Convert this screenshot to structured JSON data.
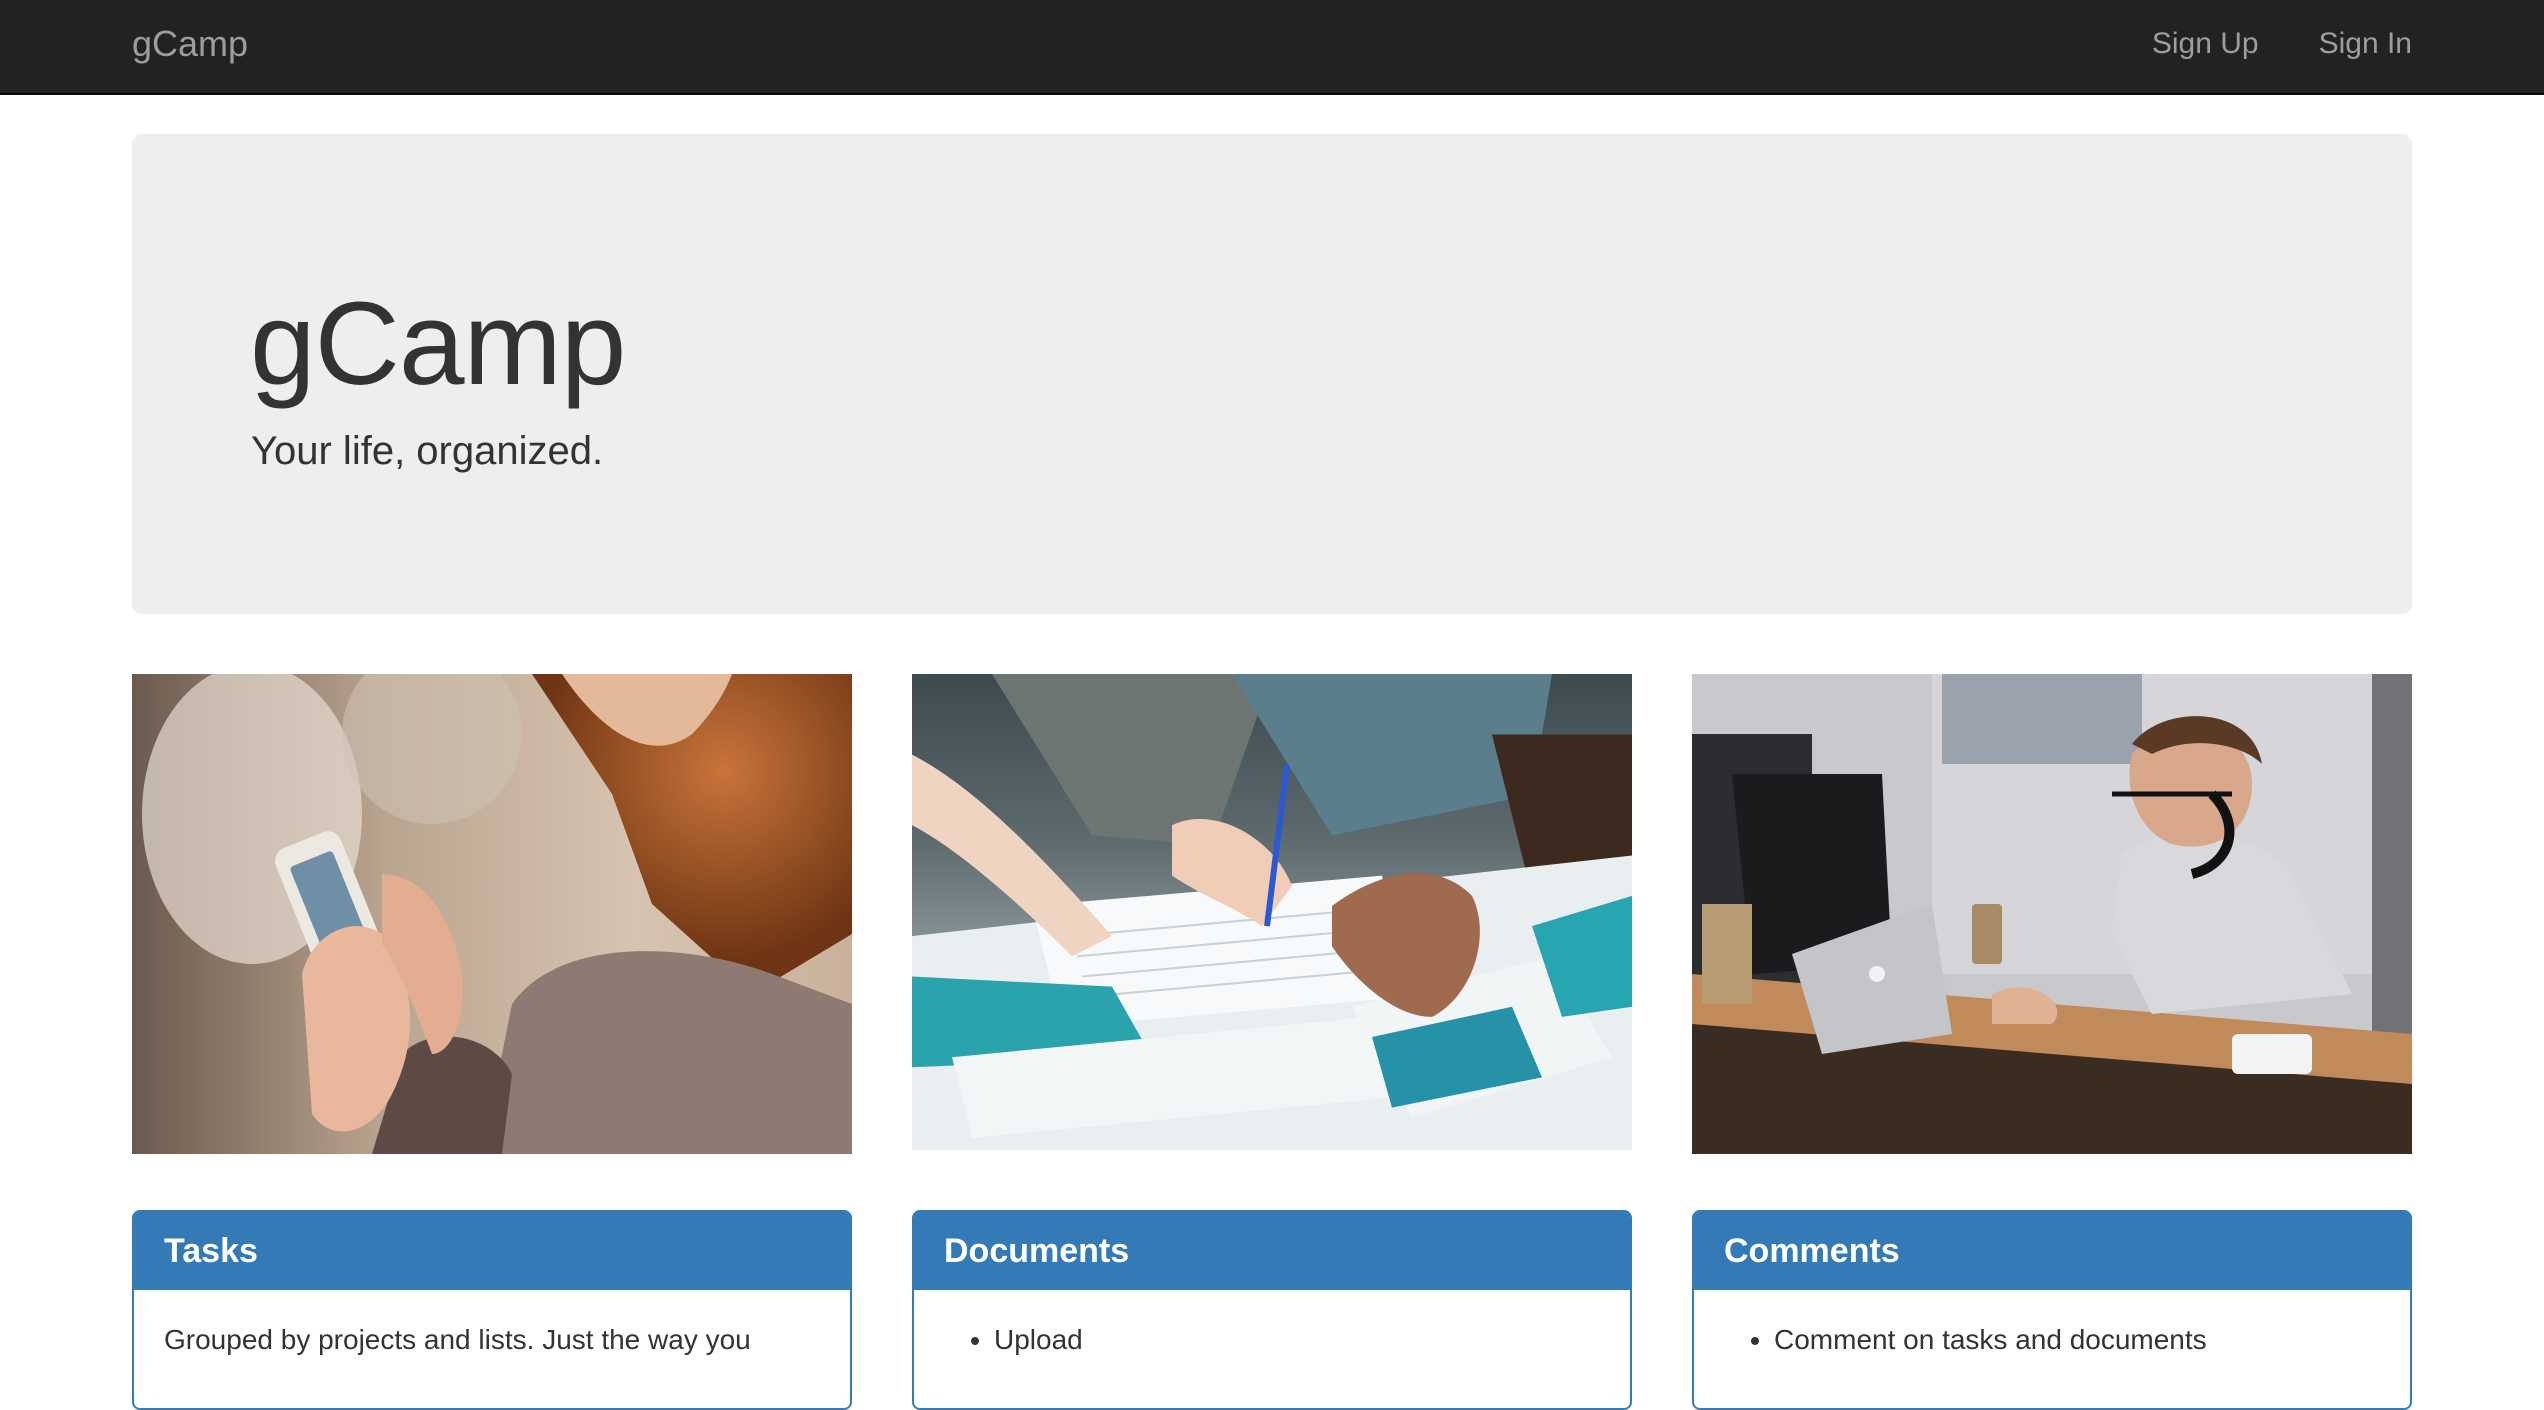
{
  "navbar": {
    "brand": "gCamp",
    "links": [
      "Sign Up",
      "Sign In"
    ]
  },
  "jumbotron": {
    "title": "gCamp",
    "subtitle": "Your life, organized."
  },
  "photos": [
    {
      "alt": "woman-using-phone",
      "icon": "photo-phone-user"
    },
    {
      "alt": "hands-reviewing-documents",
      "icon": "photo-documents"
    },
    {
      "alt": "man-working-at-laptop",
      "icon": "photo-laptop-worker"
    }
  ],
  "panels": [
    {
      "heading": "Tasks",
      "body": "Grouped by projects and lists. Just the way you"
    },
    {
      "heading": "Documents",
      "items": [
        "Upload"
      ]
    },
    {
      "heading": "Comments",
      "items": [
        "Comment on tasks and documents"
      ]
    }
  ],
  "colors": {
    "navbar_bg": "#222222",
    "navbar_text": "#9d9d9d",
    "jumbotron_bg": "#eeeeee",
    "panel_primary": "#337ab7"
  }
}
